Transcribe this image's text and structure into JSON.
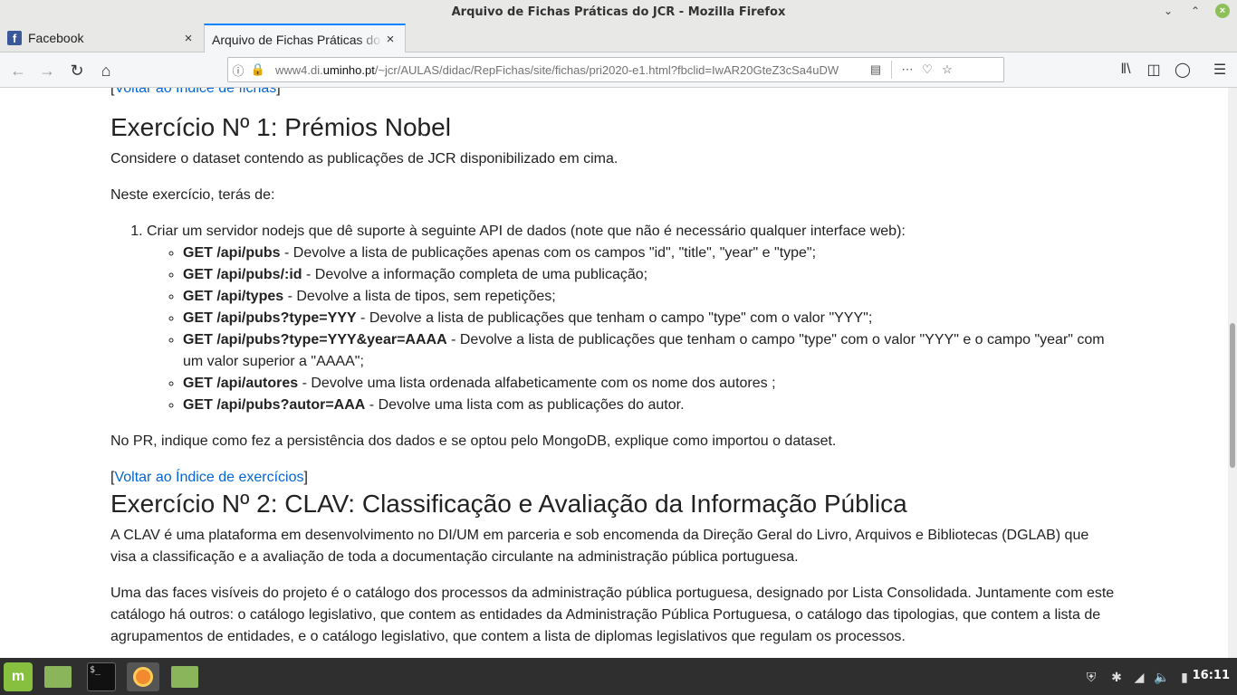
{
  "window": {
    "title": "Arquivo de Fichas Práticas do JCR - Mozilla Firefox"
  },
  "tabs": [
    {
      "label": "Facebook",
      "icon": "facebook-icon",
      "active": false
    },
    {
      "label": "Arquivo de Fichas Práticas do JCR",
      "icon": "none",
      "active": true
    }
  ],
  "urlbar": {
    "url_prefix": "www4.di.",
    "url_domain": "uminho.pt",
    "url_rest": "/~jcr/AULAS/didac/RepFichas/site/fichas/pri2020-e1.html?fbclid=IwAR20GteZ3cSa4uDW"
  },
  "content": {
    "top_link": "Voltar ao Índice de fichas",
    "ex1": {
      "title": "Exercício Nº 1: Prémios Nobel",
      "p1": "Considere o dataset contendo as publicações de JCR disponibilizado em cima.",
      "p2": "Neste exercício, terás de:",
      "item1": "Criar um servidor nodejs que dê suporte à seguinte API de dados (note que não é necessário qualquer interface web):",
      "api": [
        {
          "route": "GET /api/pubs",
          "desc": " - Devolve a lista de publicações apenas com os campos \"id\", \"title\", \"year\" e \"type\";"
        },
        {
          "route": "GET /api/pubs/:id",
          "desc": " - Devolve a informação completa de uma publicação;"
        },
        {
          "route": "GET /api/types",
          "desc": " - Devolve a lista de tipos, sem repetições;"
        },
        {
          "route": "GET /api/pubs?type=YYY",
          "desc": " - Devolve a lista de publicações que tenham o campo \"type\" com o valor \"YYY\";"
        },
        {
          "route": "GET /api/pubs?type=YYY&year=AAAA",
          "desc": " - Devolve a lista de publicações que tenham o campo \"type\" com o valor \"YYY\" e o campo \"year\" com um valor superior a \"AAAA\";"
        },
        {
          "route": "GET /api/autores",
          "desc": " - Devolve uma lista ordenada alfabeticamente com os nome dos autores ;"
        },
        {
          "route": "GET /api/pubs?autor=AAA",
          "desc": " - Devolve uma lista com as publicações do autor."
        }
      ],
      "p3": "No PR, indique como fez a persistência dos dados e se optou pelo MongoDB, explique como importou o dataset."
    },
    "back_link": "Voltar ao Índice de exercícios",
    "ex2": {
      "title": "Exercício Nº 2: CLAV: Classificação e Avaliação da Informação Pública",
      "p1": "A CLAV é uma plataforma em desenvolvimento no DI/UM em parceria e sob encomenda da Direção Geral do Livro, Arquivos e Bibliotecas (DGLAB) que visa a classificação e a avaliação de toda a documentação circulante na administração pública portuguesa.",
      "p2": "Uma das faces visíveis do projeto é o catálogo dos processos da administração pública portuguesa, designado por Lista Consolidada. Juntamente com este catálogo há outros: o catálogo legislativo, que contem as entidades da Administração Pública Portuguesa, o catálogo das tipologias, que contem a lista de agrupamentos de entidades, e o catálogo legislativo, que contem a lista de diplomas legislativos que regulam os processos."
    }
  },
  "taskbar": {
    "clock": "16:11"
  }
}
